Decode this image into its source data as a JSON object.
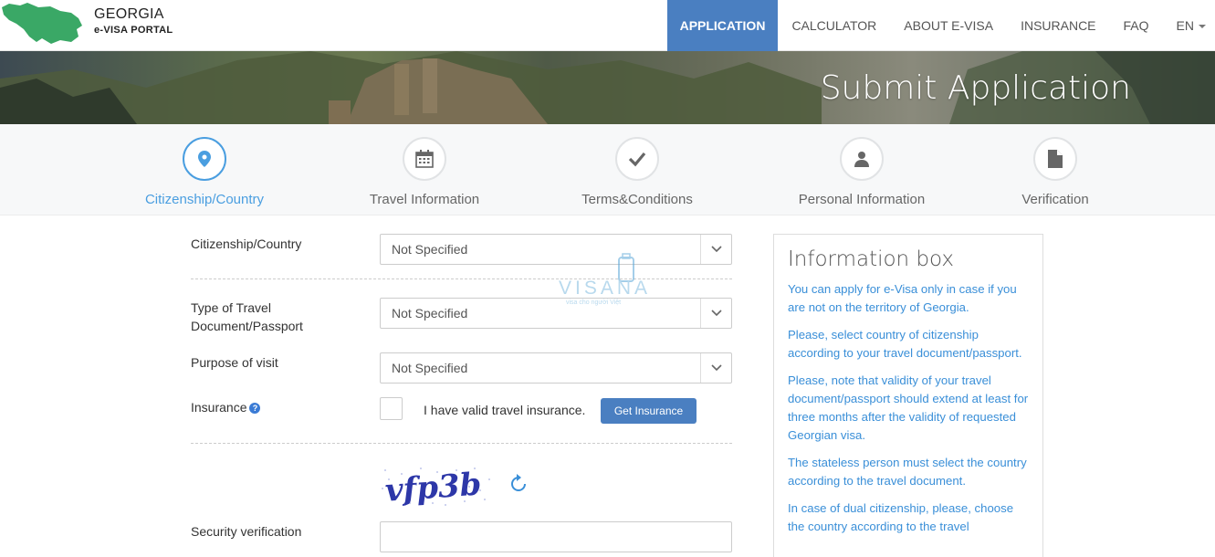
{
  "header": {
    "logo_title": "GEORGIA",
    "logo_subtitle": "e-VISA PORTAL",
    "nav": [
      "APPLICATION",
      "CALCULATOR",
      "ABOUT e-VISA",
      "INSURANCE",
      "FAQ",
      "EN"
    ]
  },
  "banner": {
    "title": "Submit Application"
  },
  "steps": [
    {
      "label": "Citizenship/Country",
      "icon": "map-marker-icon",
      "active": true
    },
    {
      "label": "Travel Information",
      "icon": "calendar-icon",
      "active": false
    },
    {
      "label": "Terms&Conditions",
      "icon": "checkmark-icon",
      "active": false
    },
    {
      "label": "Personal Information",
      "icon": "user-icon",
      "active": false
    },
    {
      "label": "Verification",
      "icon": "document-icon",
      "active": false
    }
  ],
  "form": {
    "citizenship_label": "Citizenship/Country",
    "citizenship_value": "Not Specified",
    "doc_label_line1": "Type of Travel",
    "doc_label_line2": "Document/Passport",
    "doc_value": "Not Specified",
    "purpose_label": "Purpose of visit",
    "purpose_value": "Not Specified",
    "insurance_label": "Insurance",
    "insurance_check_label": "I have valid travel insurance.",
    "get_insurance_button": "Get Insurance",
    "captcha_text": "vfp3b",
    "security_label": "Security verification",
    "security_value": ""
  },
  "infobox": {
    "title": "Information box",
    "paragraphs": [
      "You can apply for e-Visa only in case if you are not on the territory of Georgia.",
      "Please, select country of citizenship according to your travel document/passport.",
      "Please, note that validity of your travel document/passport should extend at least for three months after the validity of requested Georgian visa.",
      "The stateless person must select the country according to the travel document.",
      "In case of dual citizenship, please, choose the country according to the travel"
    ]
  },
  "watermark": {
    "brand": "VISANA",
    "tagline": "visa cho người Việt"
  },
  "colors": {
    "primary": "#4a7fc1",
    "accent": "#4a9ee0",
    "info_text": "#3a8fd8",
    "logo_green": "#3aa866"
  }
}
